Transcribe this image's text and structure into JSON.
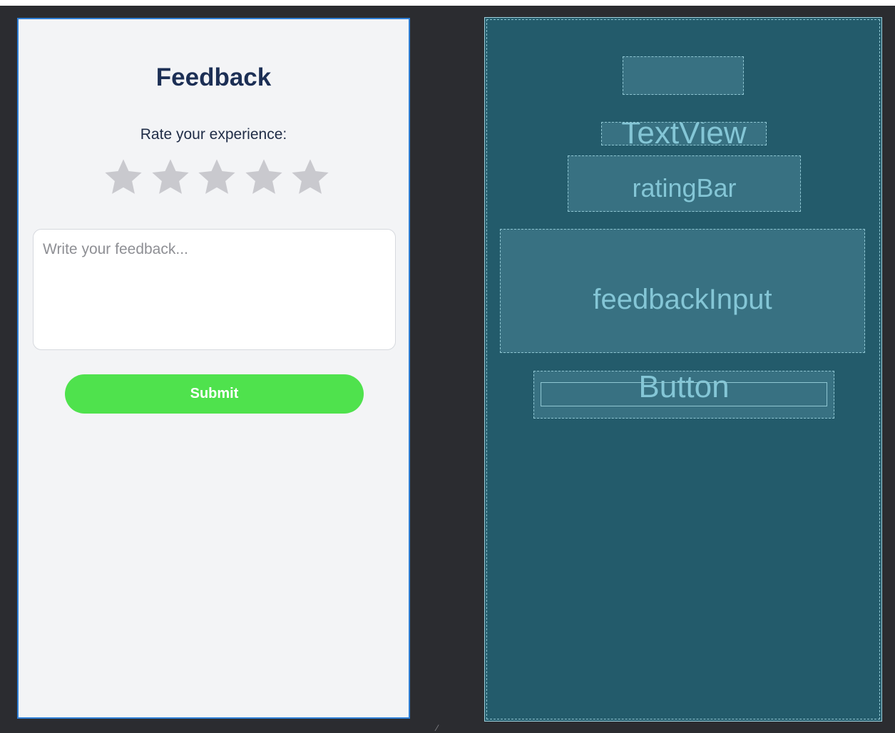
{
  "design": {
    "title": "Feedback",
    "rating_prompt": "Rate your experience:",
    "rating": {
      "value": 0,
      "max": 5
    },
    "feedback_placeholder": "Write your feedback...",
    "submit_label": "Submit",
    "colors": {
      "background": "#f3f4f6",
      "title": "#1c2f55",
      "star_inactive": "#c9c9ce",
      "submit_button": "#4fe24d",
      "selection_border": "#2f7fd6"
    }
  },
  "blueprint": {
    "textview_label": "TextView",
    "ratingbar_label": "ratingBar",
    "input_label": "feedbackInput",
    "button_label": "Button",
    "colors": {
      "background": "#235b6b",
      "outline": "#8fc6d2",
      "text": "#84c6d6"
    }
  },
  "icons": {
    "star": "star-icon",
    "resize": "resize-handle-icon"
  }
}
